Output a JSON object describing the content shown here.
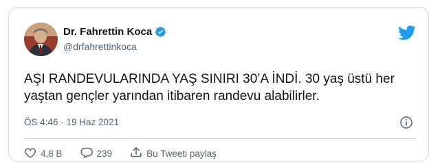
{
  "tweet": {
    "author_name": "Dr. Fahrettin Koca",
    "handle": "@drfahrettinkoca",
    "text": "AŞI RANDEVULARINDA YAŞ SINIRI 30’A İNDİ. 30 yaş üstü her yaştan gençler yarından itibaren randevu alabilirler.",
    "timestamp": "ÖS 4:46 · 19 Haz 2021",
    "likes": "4,8 B",
    "replies": "239",
    "share_label": "Bu Tweeti paylaş"
  },
  "icons": {
    "verified": "verified-badge-icon",
    "logo": "twitter-bird-icon",
    "info": "info-icon",
    "like": "heart-icon",
    "reply": "reply-icon",
    "share": "share-icon"
  },
  "colors": {
    "brand": "#1d9bf0",
    "text": "#0f1419",
    "muted": "#536471",
    "border": "#cfd9de"
  }
}
